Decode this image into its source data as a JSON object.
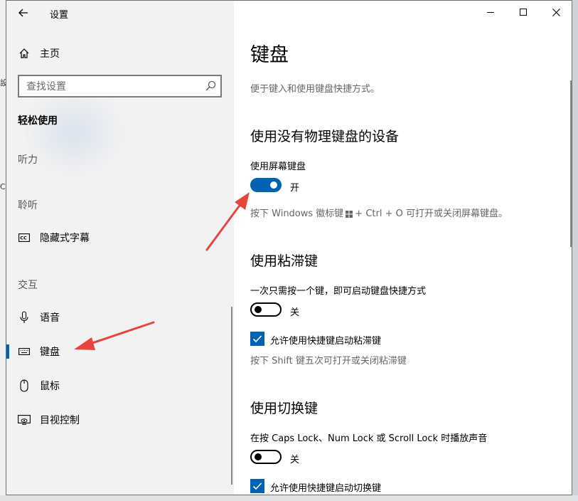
{
  "window": {
    "title": "设置"
  },
  "background": {
    "fragments": [
      "設",
      "C"
    ]
  },
  "sidebar": {
    "home_label": "主页",
    "search": {
      "placeholder": "查找设置",
      "value": ""
    },
    "category": "轻松使用",
    "sections": [
      {
        "heading": "听力",
        "items": []
      },
      {
        "heading": "聆听",
        "items": [
          {
            "label": "隐藏式字幕",
            "icon": "closed-caption-icon"
          }
        ]
      },
      {
        "heading": "交互",
        "items": [
          {
            "label": "语音",
            "icon": "microphone-icon"
          },
          {
            "label": "键盘",
            "icon": "keyboard-icon",
            "active": true
          },
          {
            "label": "鼠标",
            "icon": "mouse-icon"
          },
          {
            "label": "目视控制",
            "icon": "eye-control-icon"
          }
        ]
      }
    ]
  },
  "main": {
    "title": "键盘",
    "description": "便于键入和使用键盘快捷方式。",
    "onscreen": {
      "heading": "使用没有物理键盘的设备",
      "label": "使用屏幕键盘",
      "state": "开",
      "hint_before": "按下 Windows 徽标键",
      "hint_after": "+ Ctrl + O 可打开或关闭屏幕键盘。"
    },
    "sticky": {
      "heading": "使用粘滞键",
      "label": "一次只需按一个键，即可启动键盘快捷方式",
      "state": "关",
      "checkbox_label": "允许使用快捷键启动粘滞键",
      "hint": "按下 Shift 键五次可打开或关闭粘滞键"
    },
    "toggle_keys": {
      "heading": "使用切换键",
      "label": "在按 Caps Lock、Num Lock 或 Scroll Lock 时播放声音",
      "state": "关",
      "checkbox_label": "允许使用快捷键启动切换键"
    }
  },
  "colors": {
    "accent": "#0063b1",
    "annotation_arrow": "#e8453c",
    "sidebar_bg": "#f2f2f2"
  }
}
